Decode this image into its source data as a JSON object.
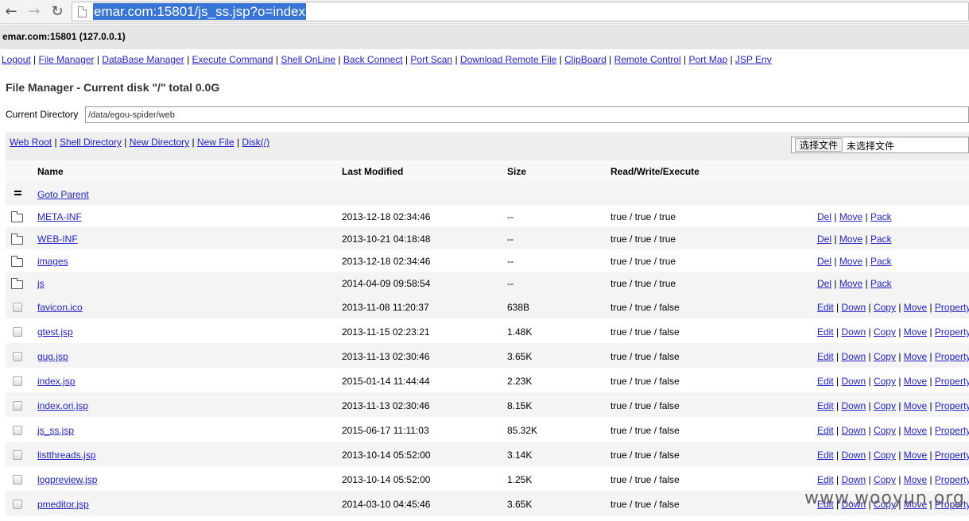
{
  "browser": {
    "url": "emar.com:15801/js_ss.jsp?o=index",
    "back_icon": "arrow-left-icon",
    "forward_icon": "arrow-right-icon",
    "reload_icon": "reload-icon"
  },
  "host": "emar.com:15801 (127.0.0.1)",
  "menu": [
    "Logout",
    "File Manager",
    "DataBase Manager",
    "Execute Command",
    "Shell OnLine",
    "Back Connect",
    "Port Scan",
    "Download Remote File",
    "ClipBoard",
    "Remote Control",
    "Port Map",
    "JSP Env"
  ],
  "title": "File Manager - Current disk \"/\" total 0.0G",
  "current_directory": {
    "label": "Current Directory",
    "value": "/data/egou-spider/web"
  },
  "actions": [
    "Web Root",
    "Shell Directory",
    "New Directory",
    "New File",
    "Disk(/)"
  ],
  "file_input": {
    "button": "选择文件",
    "text": "未选择文件"
  },
  "columns": [
    "Name",
    "Last Modified",
    "Size",
    "Read/Write/Execute"
  ],
  "parent": {
    "label": "Goto Parent",
    "icon": "parent-dir-icon"
  },
  "folders": [
    {
      "name": "META-INF",
      "modified": "2013-12-18 02:34:46",
      "size": "--",
      "rwx": "true / true / true"
    },
    {
      "name": "WEB-INF",
      "modified": "2013-10-21 04:18:48",
      "size": "--",
      "rwx": "true / true / true"
    },
    {
      "name": "images",
      "modified": "2013-12-18 02:34:46",
      "size": "--",
      "rwx": "true / true / true"
    },
    {
      "name": "js",
      "modified": "2014-04-09 09:58:54",
      "size": "--",
      "rwx": "true / true / true"
    }
  ],
  "folder_actions": [
    "Del",
    "Move",
    "Pack"
  ],
  "files": [
    {
      "name": "favicon.ico",
      "modified": "2013-11-08 11:20:37",
      "size": "638B",
      "rwx": "true / true / false"
    },
    {
      "name": "gtest.jsp",
      "modified": "2013-11-15 02:23:21",
      "size": "1.48K",
      "rwx": "true / true / false"
    },
    {
      "name": "gug.jsp",
      "modified": "2013-11-13 02:30:46",
      "size": "3.65K",
      "rwx": "true / true / false"
    },
    {
      "name": "index.jsp",
      "modified": "2015-01-14 11:44:44",
      "size": "2.23K",
      "rwx": "true / true / false"
    },
    {
      "name": "index.ori.jsp",
      "modified": "2013-11-13 02:30:46",
      "size": "8.15K",
      "rwx": "true / true / false"
    },
    {
      "name": "js_ss.jsp",
      "modified": "2015-06-17 11:11:03",
      "size": "85.32K",
      "rwx": "true / true / false"
    },
    {
      "name": "listthreads.jsp",
      "modified": "2013-10-14 05:52:00",
      "size": "3.14K",
      "rwx": "true / true / false"
    },
    {
      "name": "logpreview.jsp",
      "modified": "2013-10-14 05:52:00",
      "size": "1.25K",
      "rwx": "true / true / false"
    },
    {
      "name": "pmeditor.jsp",
      "modified": "2014-03-10 04:45:46",
      "size": "3.65K",
      "rwx": "true / true / false"
    }
  ],
  "file_actions": [
    "Edit",
    "Down",
    "Copy",
    "Move",
    "Property"
  ],
  "watermark": "www.wooyun.org"
}
